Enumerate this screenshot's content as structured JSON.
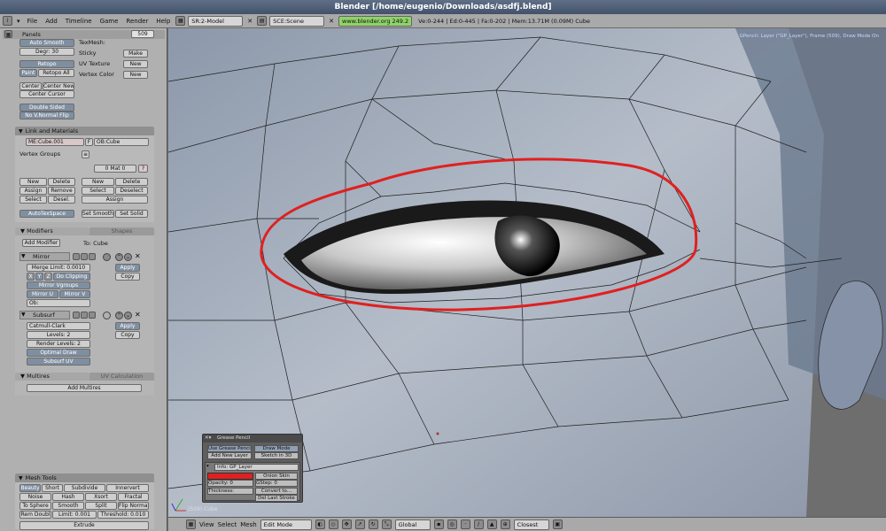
{
  "window": {
    "title": "Blender [/home/eugenio/Downloads/asdfj.blend]"
  },
  "menubar": {
    "items": [
      "File",
      "Add",
      "Timeline",
      "Game",
      "Render",
      "Help"
    ],
    "screen": "SR:2-Model",
    "scene": "SCE:Scene",
    "url": "www.blender.org 249.2",
    "stats": "Ve:0-244 | Ed:0-445 | Fa:0-202 | Mem:13.71M (0.09M) Cube"
  },
  "panels_header": {
    "label": "Panels",
    "frame": "509"
  },
  "mesh": {
    "auto_smooth": "Auto Smooth",
    "degr": "Degr: 30",
    "texmesh": "TexMesh:",
    "sticky": "Sticky",
    "sticky_btn": "Make",
    "uv_texture": "UV Texture",
    "uv_btn": "New",
    "vertex_color": "Vertex Color",
    "vc_btn": "New",
    "retopo": "Retopo",
    "paint": "Paint",
    "retopo_all": "Retopo All",
    "center": "Center",
    "center_new": "Center New",
    "center_cursor": "Center Cursor",
    "double_sided": "Double Sided",
    "no_vnormal_flip": "No V.Normal Flip"
  },
  "link": {
    "title": "Link and Materials",
    "me": "ME:Cube.001",
    "f": "F",
    "ob": "OB:Cube",
    "vertex_groups": "Vertex Groups",
    "mat": "0 Mat 0",
    "q": "?",
    "new": "New",
    "delete": "Delete",
    "assign": "Assign",
    "remove": "Remove",
    "select": "Select",
    "desel": "Desel.",
    "deselect": "Deselect",
    "autotexspace": "AutoTexSpace",
    "set_smooth": "Set Smooth",
    "set_solid": "Set Solid"
  },
  "modifiers": {
    "tab": "Modifiers",
    "tab2": "Shapes",
    "add": "Add Modifier",
    "to": "To: Cube",
    "mirror": "Mirror",
    "merge_limit": "Merge Limit: 0.0010",
    "x": "X",
    "y": "Y",
    "z": "Z",
    "do_clipping": "Do Clipping",
    "mirror_vgroups": "Mirror Vgroups",
    "mirror_u": "Mirror U",
    "mirror_v": "Mirror V",
    "ob": "Ob:",
    "apply": "Apply",
    "copy": "Copy",
    "subsurf": "Subsurf",
    "catmull": "Catmull-Clark",
    "levels": "Levels: 2",
    "render_levels": "Render Levels: 2",
    "optimal_draw": "Optimal Draw",
    "subsurf_uv": "Subsurf UV"
  },
  "multires": {
    "tab": "Multires",
    "tab2": "UV Calculation",
    "add": "Add Multires"
  },
  "meshtools": {
    "title": "Mesh Tools",
    "row1": [
      "Beauty",
      "Short",
      "Subdivide",
      "Innervert"
    ],
    "row2": [
      "Noise",
      "Hash",
      "Xsort",
      "Fractal"
    ],
    "row3": [
      "To Sphere",
      "Smooth",
      "Split",
      "Flip Normal"
    ],
    "row4": [
      "Rem Doubl",
      "Limit: 0.001",
      "Threshold: 0.010"
    ],
    "extrude": "Extrude"
  },
  "viewport": {
    "gp_info": "GPencil: Layer (\"GP_Layer\"), Frame (509), Draw Mode On",
    "obj_label": "(509) Cube"
  },
  "grease_pencil": {
    "title": "Grease Pencil",
    "use": "Use Grease Pencil",
    "draw_mode": "Draw Mode",
    "add_layer": "Add New Layer",
    "sketch3d": "Sketch in 3D",
    "info": "Info: GP_Layer",
    "onion": "Onion Skin",
    "opacity": "Opacity: 0",
    "gstep": "GStep: 0",
    "thickness": "Thickness:",
    "convert": "Convert to...",
    "del_last": "Del Last Stroke"
  },
  "bottombar": {
    "items": [
      "View",
      "Select",
      "Mesh"
    ],
    "mode": "Edit Mode",
    "orient": "Global",
    "snap": "Closest"
  },
  "colors": {
    "accent_red": "#e02020",
    "panel_bg": "#b0b0b0",
    "button_blue": "#7f8fa2"
  }
}
